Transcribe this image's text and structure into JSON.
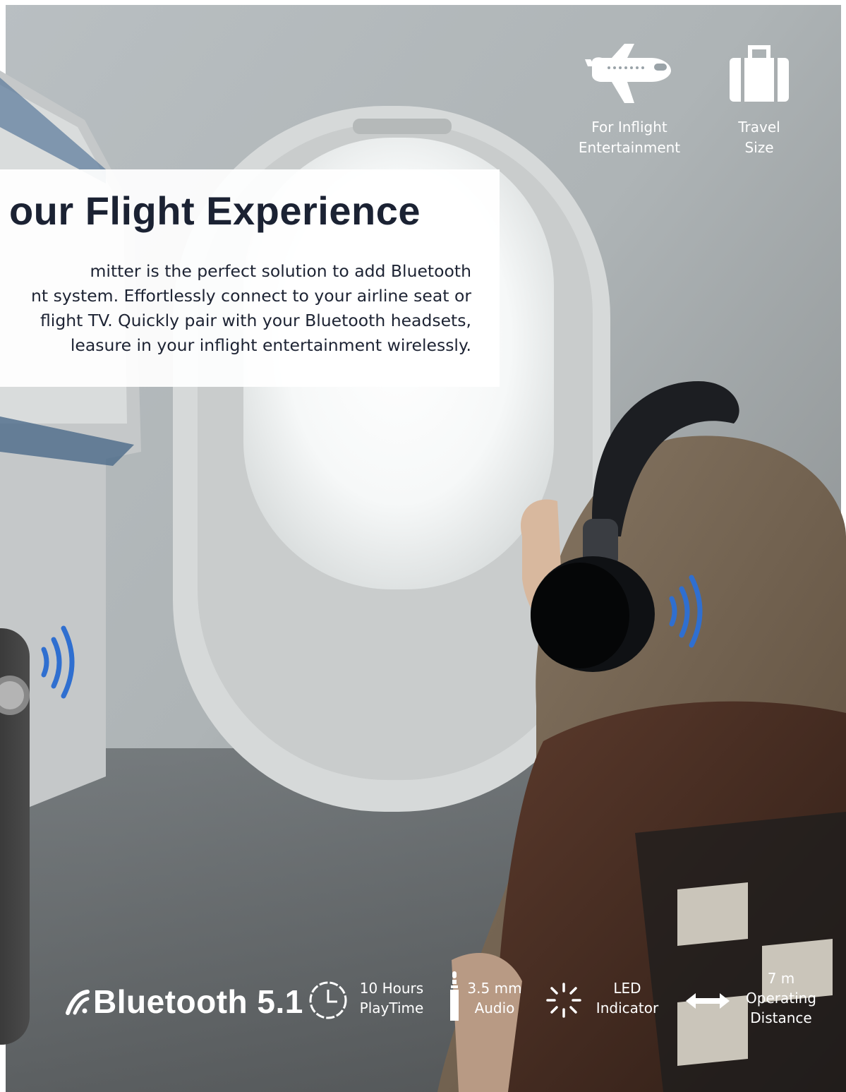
{
  "top_badges": [
    {
      "icon": "airplane-icon",
      "line1": "For Inflight",
      "line2": "Entertainment"
    },
    {
      "icon": "suitcase-icon",
      "line1": "Travel",
      "line2": "Size"
    }
  ],
  "headline": {
    "title": "our Flight Experience",
    "body_lines": [
      "mitter is the perfect solution to add Bluetooth",
      "nt system. Effortlessly connect to your airline seat or",
      "flight TV. Quickly pair with your Bluetooth headsets,",
      "leasure in your inflight entertainment wirelessly."
    ]
  },
  "features": {
    "bluetooth": {
      "icon": "bluetooth-logo-icon",
      "label": "Bluetooth 5.1"
    },
    "playtime": {
      "icon": "clock-icon",
      "line1": "10 Hours",
      "line2": "PlayTime"
    },
    "audio": {
      "icon": "audio-jack-icon",
      "line1": "3.5 mm",
      "line2": "Audio"
    },
    "led": {
      "icon": "led-indicator-icon",
      "line1": "LED",
      "line2": "Indicator"
    },
    "distance": {
      "icon": "double-arrow-icon",
      "line1": "7 m",
      "line2": "Operating",
      "line3": "Distance"
    }
  },
  "colors": {
    "accent_wave": "#2f6fd0",
    "headline_text": "#1b2233"
  }
}
